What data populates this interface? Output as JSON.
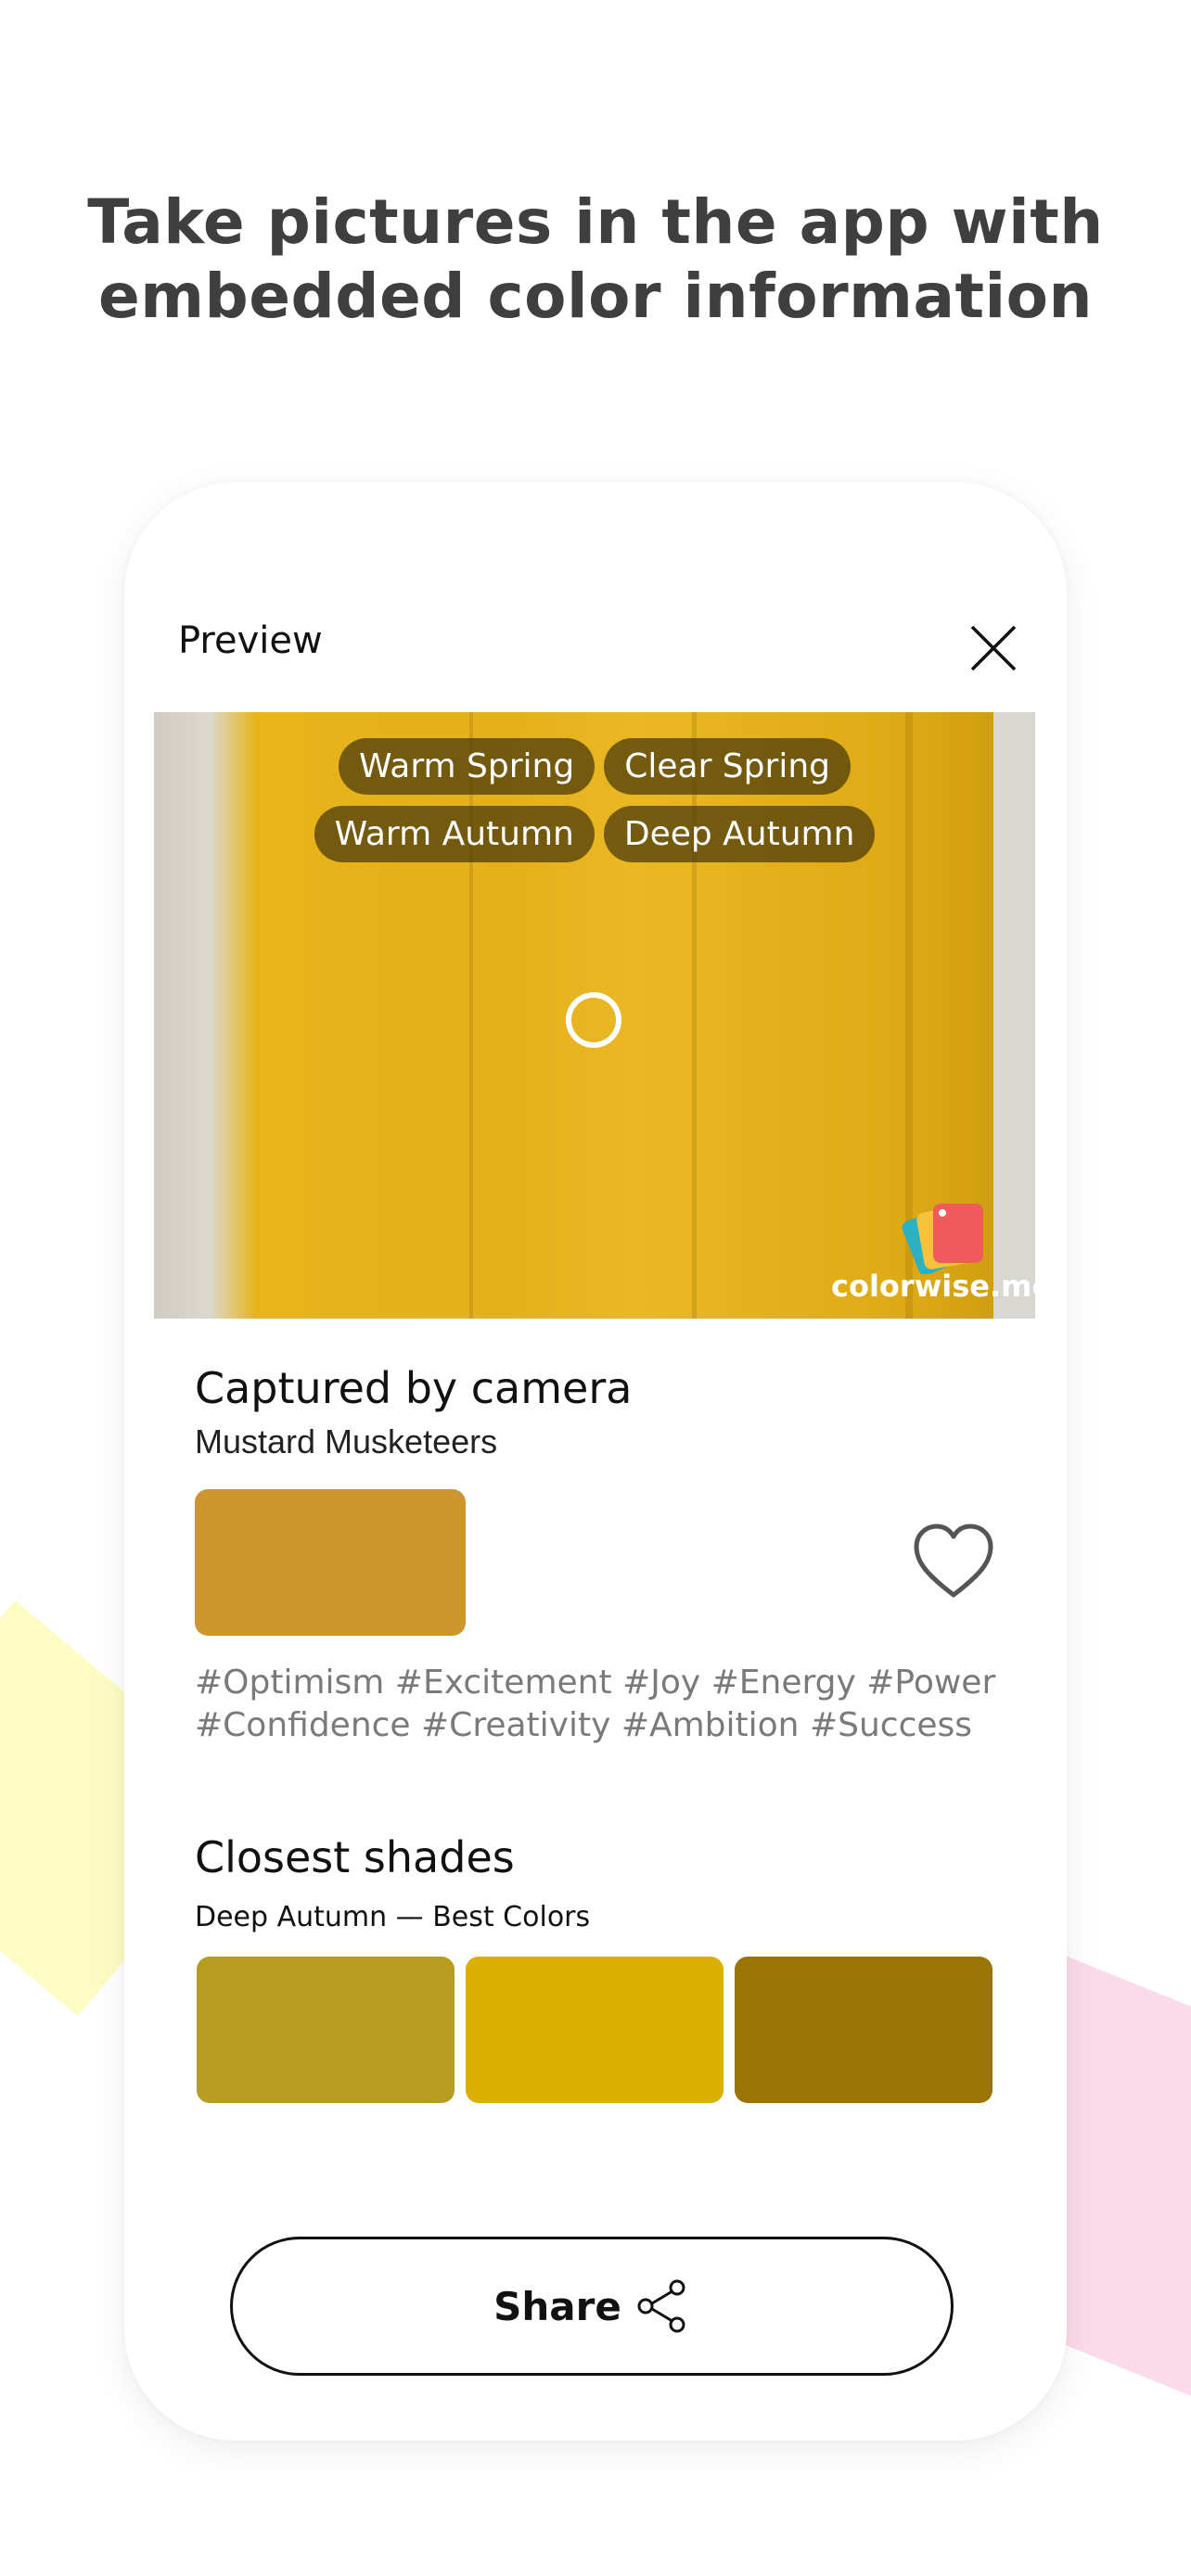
{
  "headline": {
    "line1": "Take pictures in the app with",
    "line2": "embedded color information"
  },
  "preview": {
    "title": "Preview",
    "close_icon": "close-icon"
  },
  "photo": {
    "tags_row1": [
      "Warm Spring",
      "Clear Spring"
    ],
    "tags_row2": [
      "Warm Autumn",
      "Deep Autumn"
    ],
    "watermark": "colorwise.me"
  },
  "captured": {
    "title": "Captured by camera",
    "color_name": "Mustard Musketeers",
    "swatch_color": "#CE962F",
    "hashtags": "#Optimism #Excitement #Joy #Energy #Power #Confidence #Creativity #Ambition #Success"
  },
  "shades": {
    "title": "Closest shades",
    "subtitle": "Deep Autumn — Best Colors",
    "colors": [
      "#B89C22",
      "#DBAF04",
      "#9C7405"
    ]
  },
  "share": {
    "label": "Share",
    "icon": "share-icon"
  }
}
